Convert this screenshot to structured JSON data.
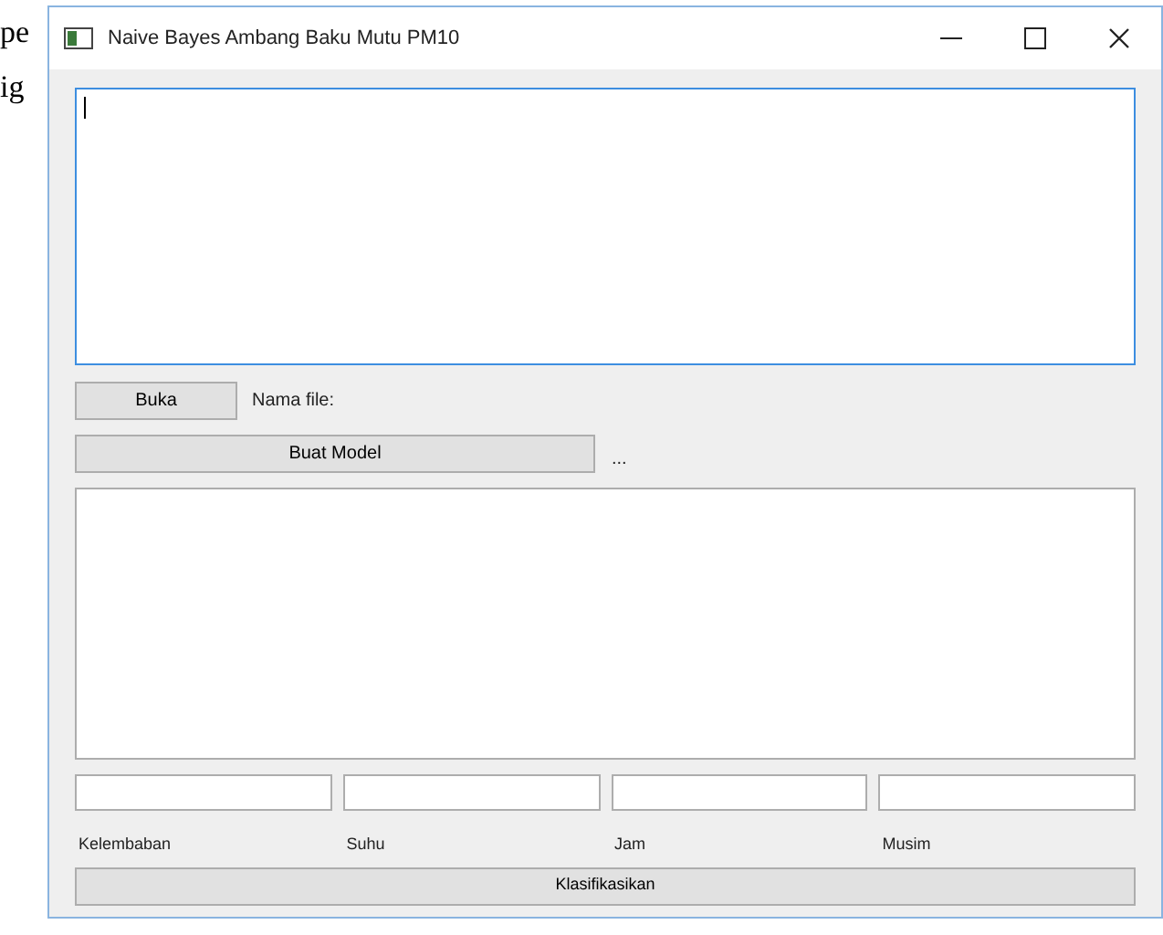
{
  "document": {
    "lines": [
      "pe",
      "ig"
    ]
  },
  "window": {
    "title": "Naive Bayes Ambang Baku Mutu PM10"
  },
  "input_area": {
    "focused": true
  },
  "open_button": "Buka",
  "file_name_label": "Nama file:",
  "build_model_button": "Buat Model",
  "model_status": "...",
  "fields": [
    {
      "label": "Kelembaban"
    },
    {
      "label": "Suhu"
    },
    {
      "label": "Jam"
    },
    {
      "label": "Musim"
    }
  ],
  "classify_button": "Klasifikasikan"
}
